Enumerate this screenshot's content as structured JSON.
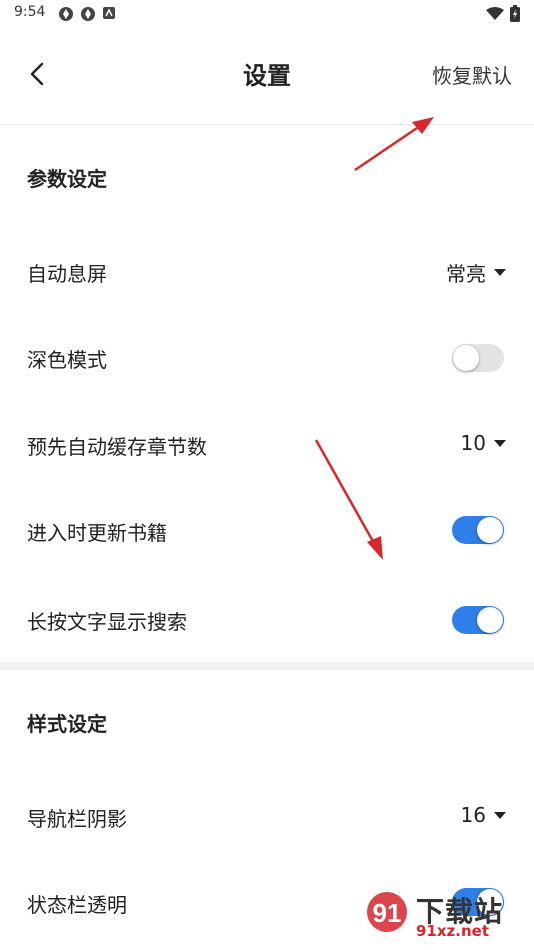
{
  "status_bar": {
    "time": "9:54",
    "left_icons": [
      "app-icon",
      "app-icon",
      "notification-icon"
    ],
    "right_icons": [
      "wifi-icon",
      "battery-icon"
    ]
  },
  "header": {
    "title": "设置",
    "reset_label": "恢复默认"
  },
  "sections": {
    "params": {
      "title": "参数设定",
      "auto_screen_off": {
        "label": "自动息屏",
        "value": "常亮"
      },
      "dark_mode": {
        "label": "深色模式",
        "enabled": false
      },
      "precache": {
        "label": "预先自动缓存章节数",
        "value": "10"
      },
      "update_on_enter": {
        "label": "进入时更新书籍",
        "enabled": true
      },
      "long_press_search": {
        "label": "长按文字显示搜索",
        "enabled": true
      }
    },
    "style": {
      "title": "样式设定",
      "navbar_shadow": {
        "label": "导航栏阴影",
        "value": "16"
      },
      "statusbar_transparent": {
        "label": "状态栏透明",
        "enabled": true
      }
    }
  },
  "watermark": {
    "line1": "下载站",
    "line2": "91xz.net"
  },
  "colors": {
    "toggle_on": "#2f7fe8",
    "toggle_off": "#e3e3e3",
    "annotation_arrow": "#d9262b"
  }
}
